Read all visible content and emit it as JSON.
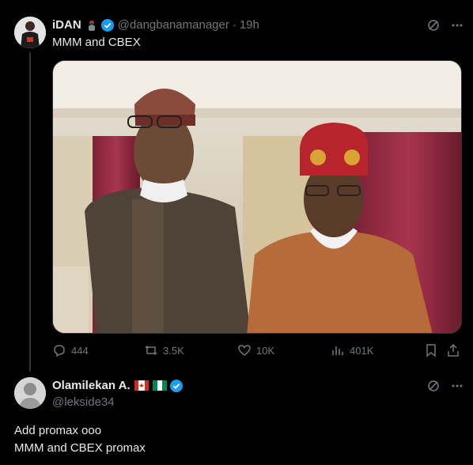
{
  "tweet": {
    "author_name": "iDAN",
    "handle": "@dangbanamanager",
    "separator": "·",
    "time": "19h",
    "text": "MMM and CBEX",
    "stats": {
      "replies": "444",
      "retweets": "3.5K",
      "likes": "10K",
      "views": "401K"
    }
  },
  "reply": {
    "author_name": "Olamilekan A.",
    "handle": "@lekside34",
    "line1": "Add promax ooo",
    "line2": "MMM and CBEX promax"
  },
  "colors": {
    "background": "#000000",
    "text": "#e7e9ea",
    "muted": "#71767b",
    "verified": "#1d9bf0"
  }
}
